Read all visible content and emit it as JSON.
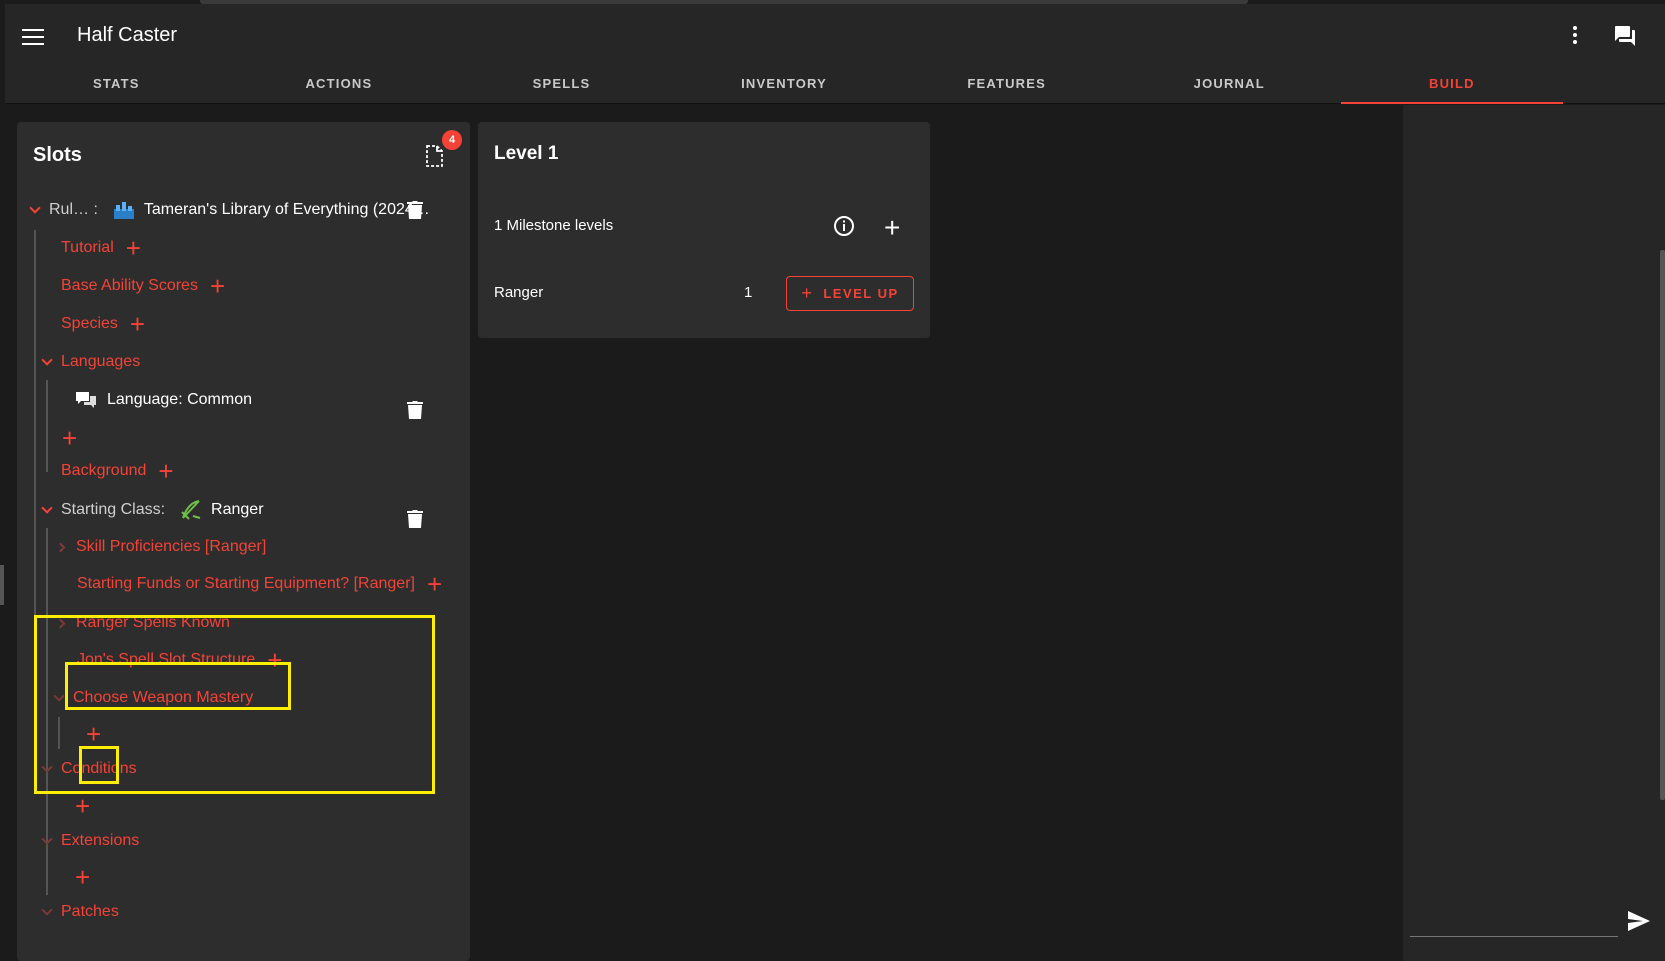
{
  "app": {
    "title": "Half Caster"
  },
  "tabs": [
    {
      "label": "STATS"
    },
    {
      "label": "ACTIONS"
    },
    {
      "label": "SPELLS"
    },
    {
      "label": "INVENTORY"
    },
    {
      "label": "FEATURES"
    },
    {
      "label": "JOURNAL"
    },
    {
      "label": "BUILD"
    }
  ],
  "active_tab": "BUILD",
  "slots": {
    "title": "Slots",
    "badge": "4",
    "rules_label": "Rul… :",
    "rules_value": "Tameran's Library of Everything (2024…",
    "tutorial": "Tutorial",
    "base_ability_scores": "Base Ability Scores",
    "species": "Species",
    "languages": "Languages",
    "language_common": "Language: Common",
    "background": "Background",
    "starting_class_label": "Starting Class:",
    "starting_class_value": "Ranger",
    "skill_proficiencies": "Skill Proficiencies [Ranger]",
    "starting_funds": "Starting Funds or Starting Equipment? [Ranger]",
    "ranger_spells_known": "Ranger Spells Known",
    "spell_slot_structure": "Jon's Spell Slot Structure",
    "choose_weapon_mastery": "Choose Weapon Mastery",
    "conditions": "Conditions",
    "extensions": "Extensions",
    "patches": "Patches"
  },
  "level_card": {
    "title": "Level 1",
    "milestone": "1 Milestone levels",
    "class_name": "Ranger",
    "class_level": "1",
    "level_up_label": "LEVEL UP"
  },
  "colors": {
    "accent": "#f44336",
    "highlight": "#ffee00",
    "panel": "#2d2d2d",
    "background": "#1b1b1b"
  }
}
